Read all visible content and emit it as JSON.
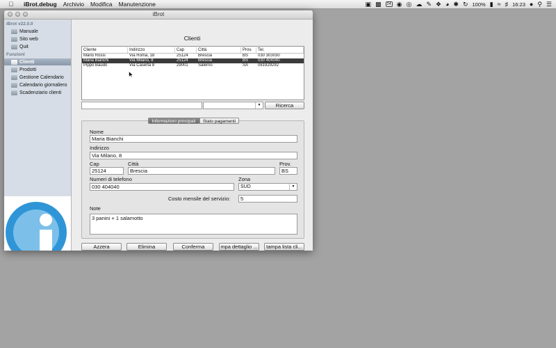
{
  "menubar": {
    "app_name": "iBrot.debug",
    "items": [
      "Archivio",
      "Modifica",
      "Manutenzione"
    ],
    "battery": "100%",
    "clock": "16:23",
    "calendar_badge": "24"
  },
  "window": {
    "title": "iBrot"
  },
  "sidebar": {
    "version": "iBrot v22.0.0",
    "top_items": [
      "Manuale",
      "Sito web",
      "Quit"
    ],
    "section": "Funzioni",
    "func_items": [
      "Clienti",
      "Prodotti",
      "Gestione Calendario",
      "Calendario giornaliero",
      "Scadenziario clienti"
    ],
    "selected": "Clienti"
  },
  "main": {
    "title": "Clienti",
    "table": {
      "headers": [
        "Cliente",
        "Indirizzo",
        "Cap",
        "Città",
        "Prov.",
        "Tel."
      ],
      "rows": [
        [
          "Mario Rossi",
          "Via Roma, 18",
          "25124",
          "Brescia",
          "BS",
          "030 303030"
        ],
        [
          "Maria Bianchi",
          "Via Milano, 8",
          "25124",
          "Brescia",
          "BS",
          "030 404040"
        ],
        [
          "Pippo Baudo",
          "Via Caserta 8",
          "29001",
          "Salerno",
          "SA",
          "081929292"
        ]
      ],
      "selected_row": 1
    },
    "search": {
      "text_value": "",
      "select_value": "",
      "button": "Ricerca"
    },
    "tabs": [
      "Informazioni principali",
      "Stato pagamenti"
    ],
    "form": {
      "nome_label": "Nome",
      "nome": "Maria Bianchi",
      "indirizzo_label": "Indirizzo",
      "indirizzo": "Via Milano, 8",
      "cap_label": "Cap",
      "cap": "25124",
      "citta_label": "Città",
      "citta": "Brescia",
      "prov_label": "Prov.",
      "prov": "BS",
      "tel_label": "Numeri di telefono",
      "tel": "030 404040",
      "zona_label": "Zona",
      "zona": "SUD",
      "costo_label": "Costo mensile del servizio:",
      "costo": "5",
      "note_label": "Note",
      "note": "3 panini + 1 salamotto"
    },
    "buttons": [
      "Azzera",
      "Elimina",
      "Conferma",
      "mpa dettaglio ...",
      "tampa lista cli..."
    ]
  }
}
